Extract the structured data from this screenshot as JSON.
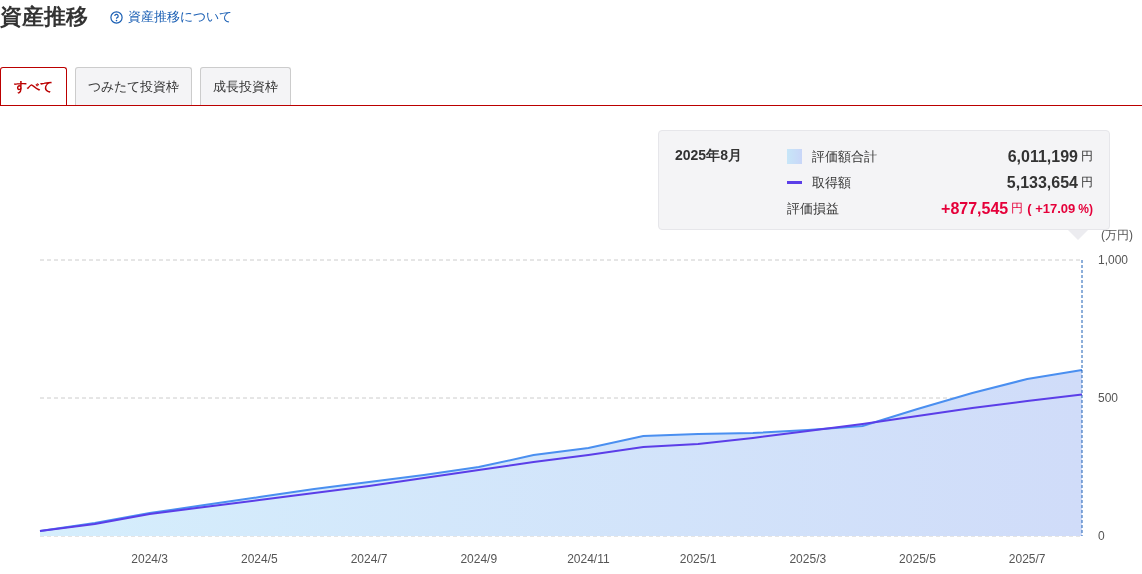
{
  "header": {
    "title": "資産推移",
    "help_link": "資産推移について"
  },
  "tabs": [
    {
      "label": "すべて",
      "selected": true
    },
    {
      "label": "つみたて投資枠",
      "selected": false
    },
    {
      "label": "成長投資枠",
      "selected": false
    }
  ],
  "tooltip": {
    "period": "2025年8月",
    "rows": [
      {
        "kind": "area",
        "value": "6,011,199",
        "unit": "円"
      },
      {
        "kind": "line",
        "value": "5,133,654",
        "unit": "円"
      },
      {
        "kind": "gain",
        "label": "評価損益",
        "value": "+877,545",
        "unit": "円",
        "percent_open": "( +17.09",
        "percent_unit": "%)"
      }
    ]
  },
  "chart_data": {
    "type": "area",
    "ylabel": "(万円)",
    "categories": [
      null,
      null,
      "2024/3",
      null,
      "2024/5",
      null,
      "2024/7",
      null,
      "2024/9",
      null,
      "2024/11",
      null,
      "2025/1",
      null,
      "2025/3",
      null,
      "2025/5",
      null,
      "2025/7",
      null
    ],
    "ylim": [
      0,
      1000
    ],
    "yticks": [
      0,
      500,
      {
        "value": 1000,
        "label": "1,000"
      }
    ],
    "series": [
      {
        "name": "評価額合計",
        "color": "#4a8ff0",
        "values": [
          18,
          47,
          83,
          112,
          141,
          170,
          196,
          221,
          250,
          293,
          319,
          362,
          370,
          373,
          384,
          399,
          460,
          518,
          569,
          601
        ]
      },
      {
        "name": "取得額",
        "type": "line",
        "color": "#5b3ee8",
        "values": [
          18,
          43,
          80,
          105,
          130,
          156,
          181,
          210,
          239,
          268,
          293,
          322,
          333,
          355,
          380,
          406,
          435,
          464,
          489,
          513
        ]
      }
    ]
  }
}
